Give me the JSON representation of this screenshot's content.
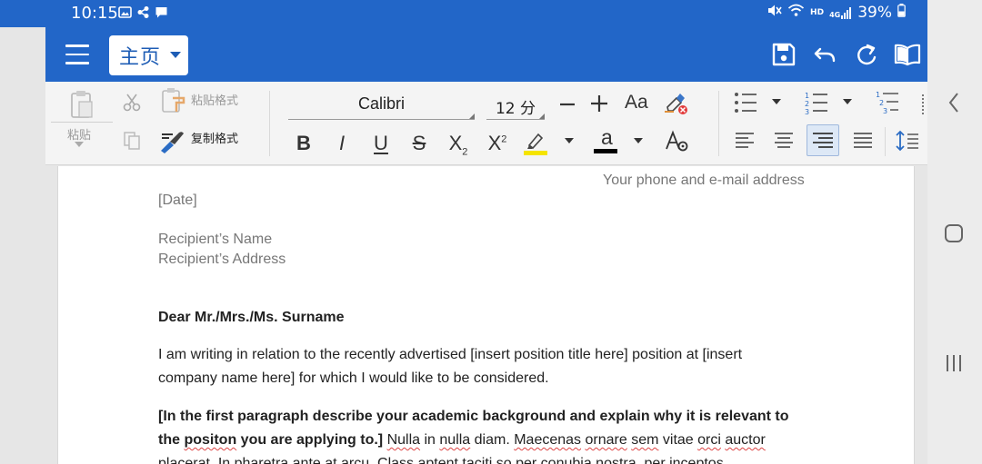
{
  "status_bar": {
    "time": "10:15",
    "network_badge": "HD",
    "signal_badge": "4G",
    "battery": "39%"
  },
  "title_bar": {
    "menu_icon": "hamburger-icon",
    "tab": "主页",
    "icons": [
      "save-icon",
      "undo-icon",
      "redo-icon",
      "read-mode-icon"
    ]
  },
  "ribbon": {
    "paste_label": "粘贴",
    "paste_format_label": "粘贴格式",
    "copy_format_label": "复制格式",
    "font_name": "Calibri",
    "font_size": "12 分",
    "change_case": "Aa",
    "bold": "B",
    "italic": "I",
    "underline": "U",
    "strike": "S",
    "subscript": "X",
    "subscript_mark": "2",
    "superscript": "X",
    "superscript_mark": "2",
    "font_color_glyph": "a",
    "highlight_color": "#f5e400",
    "font_color": "#000000"
  },
  "document": {
    "contact": "Your phone and e-mail address",
    "date": "[Date]",
    "recipient_name": "Recipient’s Name",
    "recipient_address": "Recipient’s Address",
    "salutation": "Dear Mr./Mrs./Ms. Surname",
    "para1_line1": "I am writing in relation to the recently advertised [insert position title here] position at [insert",
    "para1_line2": "company name here] for which I would like to be considered.",
    "para2_bold_line1": "[In the first paragraph describe your academic background and explain why it is relevant to",
    "para2_bold_line2a": "the ",
    "para2_bold_line2_typo": "positon",
    "para2_bold_line2b": " you are applying to.]",
    "para2_lorem_1": "Nulla",
    "para2_lorem_2": " in ",
    "para2_lorem_3": "nulla",
    "para2_lorem_4": " diam. ",
    "para2_lorem_5": "Maecenas",
    "para2_lorem_6": " ",
    "para2_lorem_7": "ornare",
    "para2_lorem_8": " ",
    "para2_lorem_9": "sem",
    "para2_lorem_10": " vitae ",
    "para2_lorem_11": "orci",
    "para2_lorem_12": " ",
    "para2_lorem_13": "auctor",
    "para2_line3": "placerat. In pharetra ante at arcu. Class aptent taciti so per conubia nostra, per inceptos"
  },
  "colors": {
    "brand_blue": "#2266c8",
    "ribbon_bg": "#f4f4f4",
    "selected_align_bg": "#dde8f6"
  }
}
